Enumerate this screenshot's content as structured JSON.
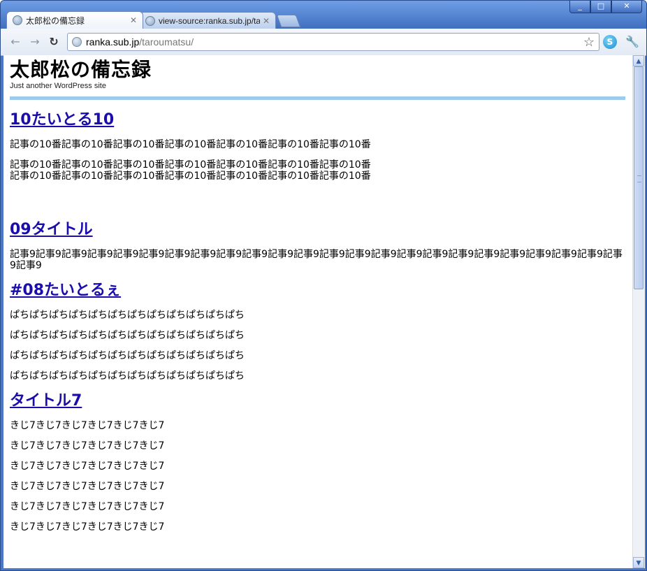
{
  "window": {
    "controls": [
      "_",
      "□",
      "✕"
    ]
  },
  "tabs": [
    {
      "label": "太郎松の備忘録",
      "active": true
    },
    {
      "label": "view-source:ranka.sub.jp/taro",
      "active": false
    }
  ],
  "toolbar": {
    "url_host": "ranka.sub.jp",
    "url_path": "/taroumatsu/"
  },
  "page": {
    "site_title": "太郎松の備忘録",
    "site_desc": "Just another WordPress site",
    "posts": [
      {
        "title": "10たいとる10",
        "paragraphs": [
          "記事の10番記事の10番記事の10番記事の10番記事の10番記事の10番記事の10番",
          "記事の10番記事の10番記事の10番記事の10番記事の10番記事の10番記事の10番\n記事の10番記事の10番記事の10番記事の10番記事の10番記事の10番記事の10番"
        ]
      },
      {
        "title": "09タイトル",
        "paragraphs": [
          "記事9記事9記事9記事9記事9記事9記事9記事9記事9記事9記事9記事9記事9記事9記事9記事9記事9記事9記事9記事9記事9記事9記事9記事9記事9"
        ]
      },
      {
        "title": "#08たいとるぇ",
        "paragraphs": [
          "ぱちぱちぱちぱちぱちぱちぱちぱちぱちぱちぱちぱち",
          "ぱちぱちぱちぱちぱちぱちぱちぱちぱちぱちぱちぱち",
          "ぱちぱちぱちぱちぱちぱちぱちぱちぱちぱちぱちぱち",
          "ぱちぱちぱちぱちぱちぱちぱちぱちぱちぱちぱちぱち"
        ]
      },
      {
        "title": "タイトル7",
        "paragraphs": [
          "きじ7きじ7きじ7きじ7きじ7きじ7",
          "きじ7きじ7きじ7きじ7きじ7きじ7",
          "きじ7きじ7きじ7きじ7きじ7きじ7",
          "きじ7きじ7きじ7きじ7きじ7きじ7",
          "きじ7きじ7きじ7きじ7きじ7きじ7",
          "きじ7きじ7きじ7きじ7きじ7きじ7"
        ]
      }
    ]
  },
  "colors": {
    "link": "#1a0dab",
    "divider": "#9ecbea",
    "chrome_frame": "#4a78c4"
  }
}
